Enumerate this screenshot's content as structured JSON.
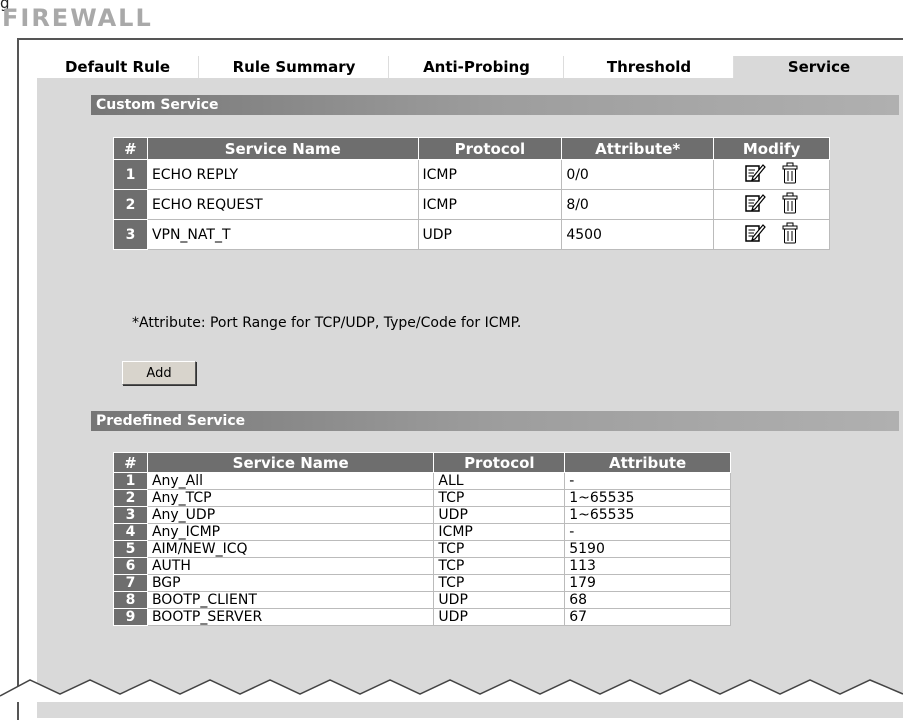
{
  "page_title": "FIREWALL",
  "top_label": "g",
  "tabs": [
    {
      "label": "Default Rule",
      "active": false
    },
    {
      "label": "Rule Summary",
      "active": false
    },
    {
      "label": "Anti-Probing",
      "active": false
    },
    {
      "label": "Threshold",
      "active": false
    },
    {
      "label": "Service",
      "active": true
    }
  ],
  "custom_service": {
    "header": "Custom Service",
    "columns": [
      "#",
      "Service Name",
      "Protocol",
      "Attribute*",
      "Modify"
    ],
    "rows": [
      {
        "num": "1",
        "name": "ECHO REPLY",
        "protocol": "ICMP",
        "attribute": "0/0"
      },
      {
        "num": "2",
        "name": "ECHO REQUEST",
        "protocol": "ICMP",
        "attribute": "8/0"
      },
      {
        "num": "3",
        "name": "VPN_NAT_T",
        "protocol": "UDP",
        "attribute": "4500"
      }
    ],
    "note": "*Attribute: Port Range for TCP/UDP, Type/Code for ICMP.",
    "add_label": "Add"
  },
  "predefined_service": {
    "header": "Predefined Service",
    "columns": [
      "#",
      "Service Name",
      "Protocol",
      "Attribute"
    ],
    "rows": [
      {
        "num": "1",
        "name": "Any_All",
        "protocol": "ALL",
        "attribute": "-"
      },
      {
        "num": "2",
        "name": "Any_TCP",
        "protocol": "TCP",
        "attribute": "1~65535"
      },
      {
        "num": "3",
        "name": "Any_UDP",
        "protocol": "UDP",
        "attribute": "1~65535"
      },
      {
        "num": "4",
        "name": "Any_ICMP",
        "protocol": "ICMP",
        "attribute": "-"
      },
      {
        "num": "5",
        "name": "AIM/NEW_ICQ",
        "protocol": "TCP",
        "attribute": "5190"
      },
      {
        "num": "6",
        "name": "AUTH",
        "protocol": "TCP",
        "attribute": "113"
      },
      {
        "num": "7",
        "name": "BGP",
        "protocol": "TCP",
        "attribute": "179"
      },
      {
        "num": "8",
        "name": "BOOTP_CLIENT",
        "protocol": "UDP",
        "attribute": "68"
      },
      {
        "num": "9",
        "name": "BOOTP_SERVER",
        "protocol": "UDP",
        "attribute": "67"
      }
    ]
  },
  "icons": {
    "edit": "edit-icon",
    "delete": "trash-icon"
  }
}
